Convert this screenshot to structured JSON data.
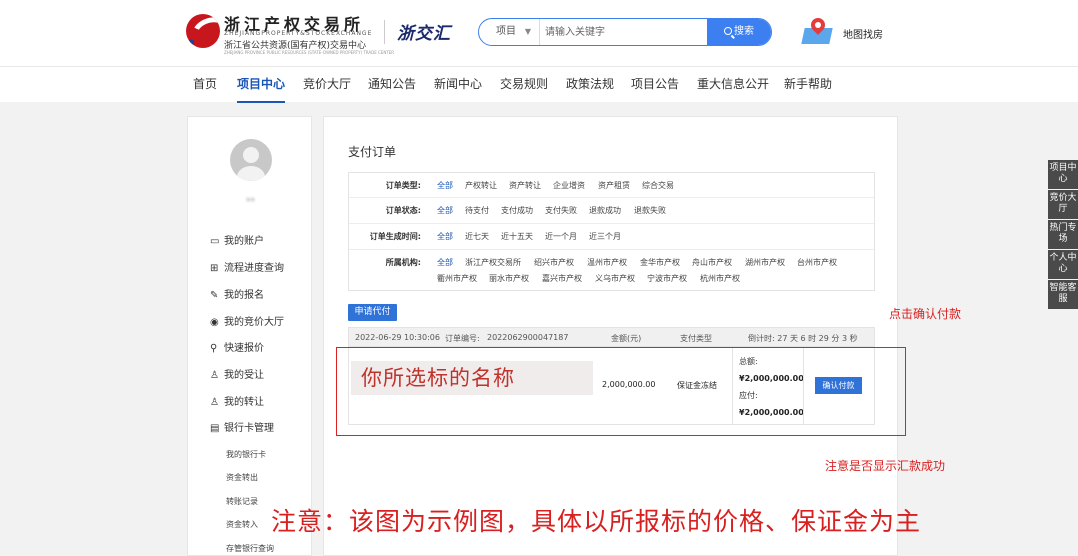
{
  "header": {
    "logo_cn": "浙江产权交易所",
    "logo_en": "ZHEJIANGPROPERTY&STOCKEXCHANGE",
    "logo_sub": "浙江省公共资源(国有产权)交易中心",
    "logo_tiny": "ZHEJIANG PROVINCE PUBLIC RESOURCES (STATE-OWNED PROPERTY) TRADE CENTER",
    "brand2": "浙交汇",
    "search": {
      "select_label": "项目",
      "placeholder": "请输入关键字",
      "button_label": "搜索"
    },
    "map_label": "地图找房"
  },
  "nav": {
    "items": [
      {
        "label": "首页"
      },
      {
        "label": "项目中心"
      },
      {
        "label": "竞价大厅"
      },
      {
        "label": "通知公告"
      },
      {
        "label": "新闻中心"
      },
      {
        "label": "交易规则"
      },
      {
        "label": "政策法规"
      },
      {
        "label": "项目公告"
      },
      {
        "label": "重大信息公开"
      },
      {
        "label": "新手帮助"
      }
    ],
    "active": "项目中心"
  },
  "sidebar": {
    "username": "**",
    "items": [
      {
        "label": "我的账户",
        "icon": "wallet-icon"
      },
      {
        "label": "流程进度查询",
        "icon": "progress-icon"
      },
      {
        "label": "我的报名",
        "icon": "edit-icon"
      },
      {
        "label": "我的竞价大厅",
        "icon": "auction-icon"
      },
      {
        "label": "快速报价",
        "icon": "quote-icon"
      },
      {
        "label": "我的受让",
        "icon": "user-icon"
      },
      {
        "label": "我的转让",
        "icon": "user-icon"
      },
      {
        "label": "银行卡管理",
        "icon": "card-icon"
      }
    ],
    "subitems": [
      {
        "label": "我的银行卡"
      },
      {
        "label": "资金转出"
      },
      {
        "label": "转账记录"
      },
      {
        "label": "资金转入"
      },
      {
        "label": "存管银行查询"
      }
    ]
  },
  "main": {
    "title": "支付订单",
    "filters": [
      {
        "label": "订单类型:",
        "options": [
          "全部",
          "产权转让",
          "资产转让",
          "企业增资",
          "资产租赁",
          "综合交易"
        ]
      },
      {
        "label": "订单状态:",
        "options": [
          "全部",
          "待支付",
          "支付成功",
          "支付失败",
          "退款成功",
          "退款失败"
        ]
      },
      {
        "label": "订单生成时间:",
        "options": [
          "全部",
          "近七天",
          "近十五天",
          "近一个月",
          "近三个月"
        ]
      },
      {
        "label": "所属机构:",
        "options": [
          "全部",
          "浙江产权交易所",
          "绍兴市产权",
          "温州市产权",
          "金华市产权",
          "舟山市产权",
          "湖州市产权",
          "台州市产权",
          "衢州市产权",
          "丽水市产权",
          "嘉兴市产权",
          "义乌市产权",
          "宁波市产权",
          "杭州市产权"
        ]
      }
    ],
    "apply_button": "申请代付",
    "order": {
      "datetime": "2022-06-29  10:30:06",
      "order_no_label": "订单编号:",
      "order_no": "2022062900047187",
      "amount_label": "金额(元)",
      "paytype_label": "支付类型",
      "countdown": "倒计时: 27 天 6 时 29 分 3 秒",
      "project_name": "你所选标的名称",
      "amount": "2,000,000.00",
      "paytype": "保证金冻结",
      "total_label": "总额:",
      "total": "¥2,000,000.00",
      "payable_label": "应付:",
      "payable": "¥2,000,000.00",
      "confirm_button": "确认付款"
    }
  },
  "annotations": {
    "note1": "点击确认付款",
    "note2": "注意是否显示汇款成功",
    "note3": "注意：该图为示例图，具体以所报标的价格、保证金为主"
  },
  "float_tabs": [
    "项目中心",
    "竞价大厅",
    "热门专场",
    "个人中心",
    "智能客服"
  ],
  "colors": {
    "accent": "#2f72d8",
    "annotation": "#d82020",
    "nav_active": "#1a56b8"
  }
}
